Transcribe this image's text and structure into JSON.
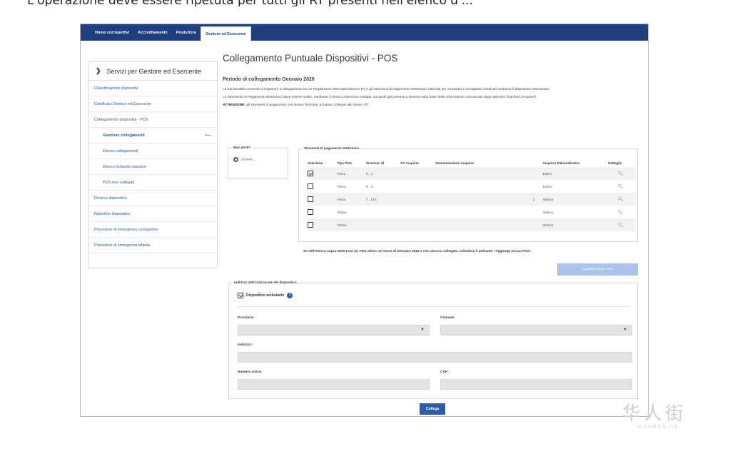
{
  "caption": "L'operazione deve essere ripetuta per tutti gli RT presenti nell'elenco d'...",
  "nav": {
    "items": [
      "Home corrispettivi",
      "Accreditamento",
      "Produttore",
      "Gestore ed Esercente"
    ],
    "active_index": 3
  },
  "sidebar": {
    "title": "Servizi per Gestore ed Esercente",
    "items": [
      {
        "label": "Classificazione dispositivi",
        "kind": "link"
      },
      {
        "label": "Certificato Gestore ed Esercente",
        "kind": "link"
      },
      {
        "label": "Collegamento dispositivi - POS",
        "kind": "group"
      },
      {
        "label": "Gestione collegamenti",
        "kind": "current"
      },
      {
        "label": "Elenco collegamenti",
        "kind": "sub"
      },
      {
        "label": "Elenco richieste massive",
        "kind": "sub"
      },
      {
        "label": "POS non collegati",
        "kind": "sub"
      },
      {
        "label": "Ricerca dispositivo",
        "kind": "link"
      },
      {
        "label": "Ripristino dispositivo",
        "kind": "link"
      },
      {
        "label": "Procedure di emergenza corrispettivi",
        "kind": "link"
      },
      {
        "label": "Procedure di emergenza lotteria",
        "kind": "link"
      }
    ]
  },
  "main": {
    "title": "Collegamento Puntuale Dispositivi - POS",
    "period": "Periodo di collegamento Gennaio 2026",
    "para1": "La funzionalità consente di registrare il collegamento tra un Registratore Telematico/Server RT e gli Strumenti di Pagamento Elettronico utilizzati per incassare i corrispettivi certificati mediante il dispositivo selezionato.",
    "para2": "Lo Strumento di Pagamento Elettronico deve essere scelto, mediante il check a selezione multipla, tra quelli già presenti a sistema sulla base delle informazioni comunicate dagli operatori finanziari (Acquirer).",
    "para3_bold": "ATTENZIONE:",
    "para3": " gli strumenti di pagamento con stesso Terminal_Id vanno collegati allo stesso RT"
  },
  "marca": {
    "legend": "Marca/e RT",
    "value": "ST/###/..."
  },
  "strumenti": {
    "legend": "Strumenti di pagamento elettronico",
    "columns": [
      "Selezione",
      "Tipo POS",
      "Terminal_Id",
      "CF Acquirer",
      "Denominazione Acquirer",
      "Acquirer Italiano/Estero",
      "Dettaglio"
    ],
    "rows": [
      {
        "checked": true,
        "tipo": "Fisico",
        "terminal": "9…1",
        "cf": "",
        "den": "",
        "acq": "Estero"
      },
      {
        "checked": false,
        "tipo": "Fisico",
        "terminal": "9…3",
        "cf": "",
        "den": "",
        "acq": "Estero"
      },
      {
        "checked": false,
        "tipo": "Fisico",
        "terminal": "7…018",
        "cf": "",
        "den": "1.",
        "acq": "Italiano"
      },
      {
        "checked": false,
        "tipo": "Online",
        "terminal": "",
        "cf": "",
        "den": "",
        "acq": "Italiano"
      },
      {
        "checked": false,
        "tipo": "Online",
        "terminal": "",
        "cf": "",
        "den": "",
        "acq": "Italiano"
      }
    ]
  },
  "note": "Se nell'elenco sopra NON trovi un POS attivo nel mese di Gennaio 2026 e non ancora collegato, seleziona il pulsante \"Aggiungi nuovo POS\".",
  "add_button": "Aggiungi nuovo POS",
  "indirizzo": {
    "legend": "Indirizzo dell'unità locale del dispositivo",
    "checkbox_label": "Dispositivo ambulante",
    "provincia_label": "Provincia:",
    "comune_label": "Comune:",
    "indirizzo_label": "Indirizzo:",
    "civico_label": "Numero civico:",
    "cap_label": "CAP:"
  },
  "collega_button": "Collega",
  "watermark": {
    "cn": "华人街",
    "en": "HUARENJIE"
  }
}
